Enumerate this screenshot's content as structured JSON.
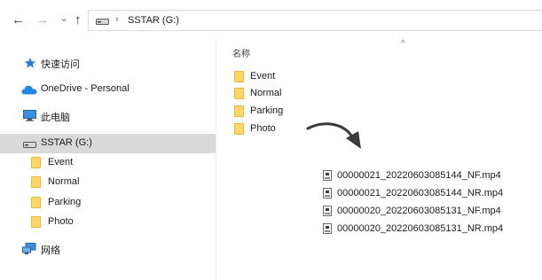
{
  "toolbar": {
    "back_glyph": "←",
    "forward_glyph": "→",
    "recent_glyph": "⌄",
    "up_glyph": "↑",
    "breadcrumb_separator": "›",
    "breadcrumb_location": "SSTAR (G:)"
  },
  "sidebar": {
    "quick_access": "快速访问",
    "onedrive": "OneDrive - Personal",
    "this_pc": "此电脑",
    "drive": "SSTAR (G:)",
    "folders": [
      "Event",
      "Normal",
      "Parking",
      "Photo"
    ],
    "network": "网络"
  },
  "main": {
    "column_name": "名称",
    "sort_indicator": "^",
    "folders": [
      "Event",
      "Normal",
      "Parking",
      "Photo"
    ],
    "files": [
      "00000021_20220603085144_NF.mp4",
      "00000021_20220603085144_NR.mp4",
      "00000020_20220603085131_NF.mp4",
      "00000020_20220603085131_NR.mp4"
    ]
  },
  "icons": {
    "quick_access": "star-icon",
    "onedrive": "cloud-icon",
    "this_pc": "monitor-icon",
    "drive": "drive-icon",
    "folder": "folder-icon",
    "network": "network-icon",
    "file": "video-file-icon",
    "annotation": "curved-arrow-icon"
  },
  "colors": {
    "selected_background": "#d9d9d9",
    "folder_yellow": "#ffd664",
    "onedrive_blue": "#1e88e5",
    "star_blue": "#2d7ad6"
  }
}
